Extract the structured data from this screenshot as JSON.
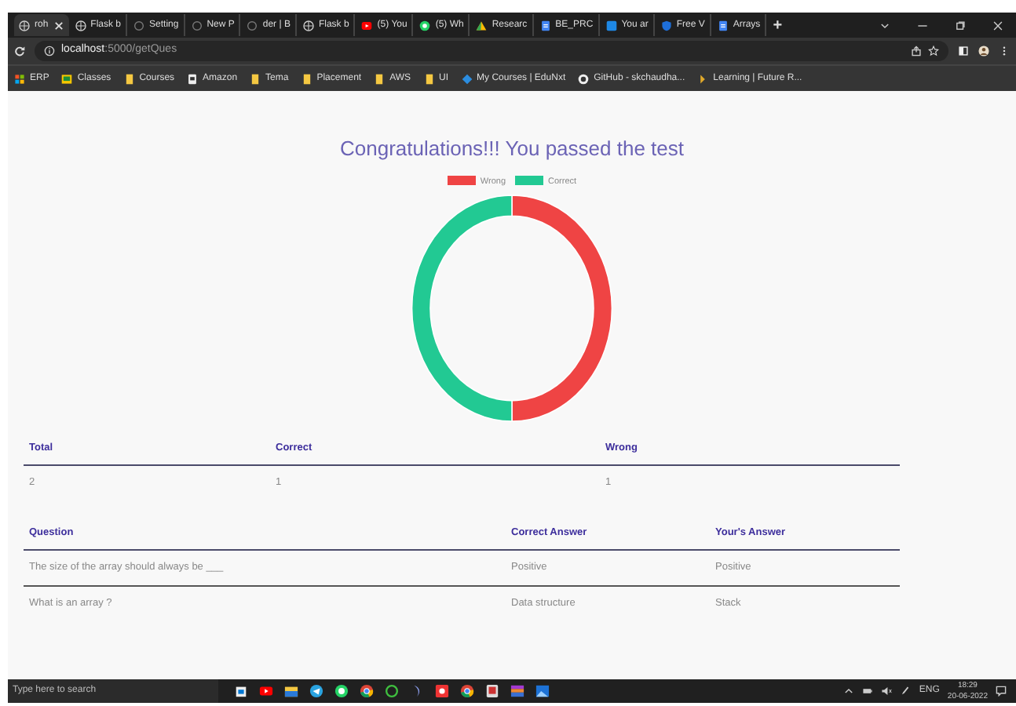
{
  "browser": {
    "tabs": [
      {
        "label": "roh",
        "kind": "globe",
        "selected": true
      },
      {
        "label": "Flask b",
        "kind": "globe",
        "selected": false
      },
      {
        "label": "Setting",
        "kind": "ring",
        "selected": false
      },
      {
        "label": "New P",
        "kind": "ring",
        "selected": false
      },
      {
        "label": "der | B",
        "kind": "ring",
        "selected": false
      },
      {
        "label": "Flask b",
        "kind": "globe",
        "selected": false
      },
      {
        "label": "(5) You",
        "kind": "video",
        "selected": false
      },
      {
        "label": "(5) Wh",
        "kind": "chat",
        "selected": false
      },
      {
        "label": "Researc",
        "kind": "drive",
        "selected": false
      },
      {
        "label": "BE_PRC",
        "kind": "doc",
        "selected": false
      },
      {
        "label": "You ar",
        "kind": "letter",
        "selected": false
      },
      {
        "label": "Free V",
        "kind": "shield",
        "selected": false
      },
      {
        "label": "Arrays",
        "kind": "doc",
        "selected": false
      }
    ],
    "new_tab": "+",
    "address": {
      "host": "localhost",
      "path": ":5000/getQues"
    },
    "bookmarks": [
      {
        "label": "ERP",
        "kind": "grid"
      },
      {
        "label": "Classes",
        "kind": "class"
      },
      {
        "label": "Courses",
        "kind": "folder"
      },
      {
        "label": "Amazon",
        "kind": "page"
      },
      {
        "label": "Tema",
        "kind": "folder"
      },
      {
        "label": "Placement",
        "kind": "folder"
      },
      {
        "label": "AWS",
        "kind": "folder"
      },
      {
        "label": "UI",
        "kind": "folder"
      },
      {
        "label": "My Courses | EduNxt",
        "kind": "diamond"
      },
      {
        "label": "GitHub - skchaudha...",
        "kind": "github"
      },
      {
        "label": "Learning | Future R...",
        "kind": "arrow"
      }
    ]
  },
  "page": {
    "title": "Congratulations!!! You passed the test",
    "chart_data": {
      "type": "donut",
      "categories": [
        "Wrong",
        "Correct"
      ],
      "values": [
        50,
        50
      ],
      "colors": [
        "#ef4444",
        "#22c993"
      ]
    },
    "summary": {
      "columns": [
        "Total",
        "Correct",
        "Wrong"
      ],
      "rows": [
        [
          "2",
          "1",
          "1"
        ]
      ]
    },
    "answers": {
      "columns": [
        "Question",
        "Correct Answer",
        "Your's Answer"
      ],
      "rows": [
        [
          "The size of the array should always be ___",
          "Positive",
          "Positive"
        ],
        [
          "What is an array ?",
          "Data structure",
          "Stack"
        ]
      ]
    }
  },
  "taskbar": {
    "search_placeholder": "Type here to search",
    "language": "ENG",
    "time": "18:29",
    "date": "20-06-2022"
  }
}
